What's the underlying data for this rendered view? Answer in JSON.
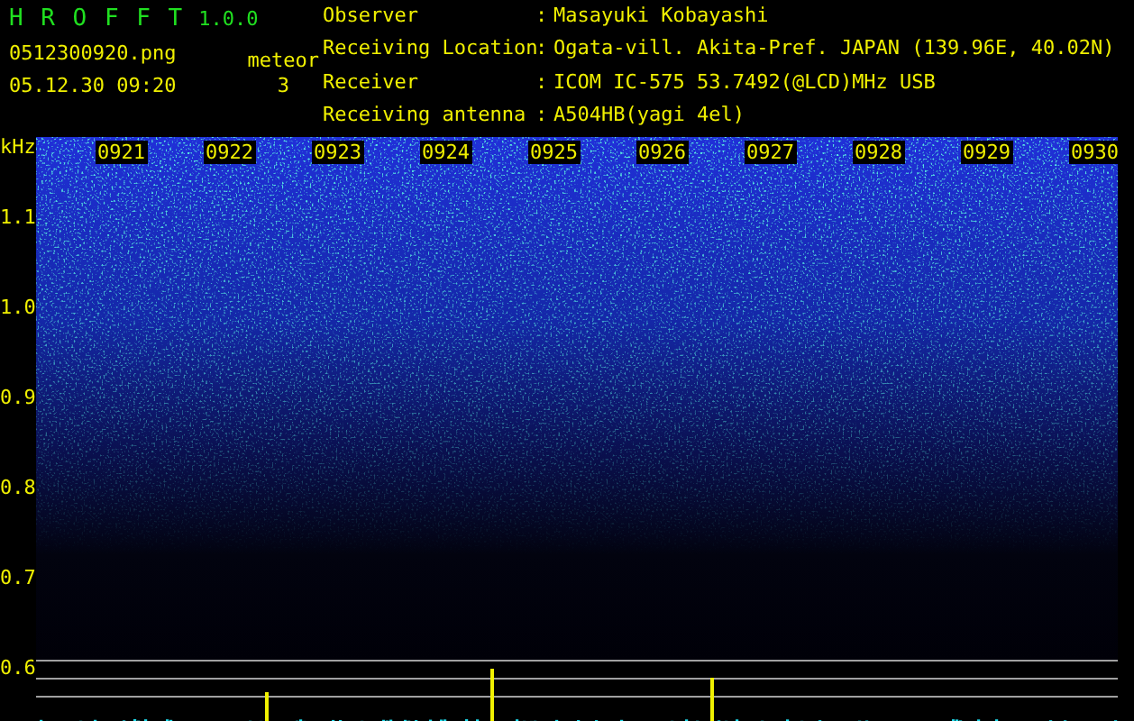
{
  "app": {
    "title": "H R O F F T",
    "version": "1.0.0",
    "file": "0512300920.png",
    "datetime": "05.12.30 09:20",
    "meteor_label": "meteor",
    "meteor_count": "3"
  },
  "info": [
    {
      "label": "Observer",
      "sep": ":",
      "value": "Masayuki Kobayashi"
    },
    {
      "label": "Receiving Location",
      "sep": ":",
      "value": "Ogata-vill. Akita-Pref. JAPAN (139.96E, 40.02N)"
    },
    {
      "label": "Receiver",
      "sep": ":",
      "value": "ICOM IC-575 53.7492(@LCD)MHz USB"
    },
    {
      "label": "Receiving antenna",
      "sep": ":",
      "value": "A504HB(yagi 4el)"
    }
  ],
  "spectrogram": {
    "unit": "kHz",
    "freq_labels": [
      "1.1",
      "1.0",
      "0.9",
      "0.8",
      "0.7",
      "0.6"
    ],
    "time_labels": [
      "0921",
      "0922",
      "0923",
      "0924",
      "0925",
      "0926",
      "0927",
      "0928",
      "0929",
      "0930"
    ]
  }
}
